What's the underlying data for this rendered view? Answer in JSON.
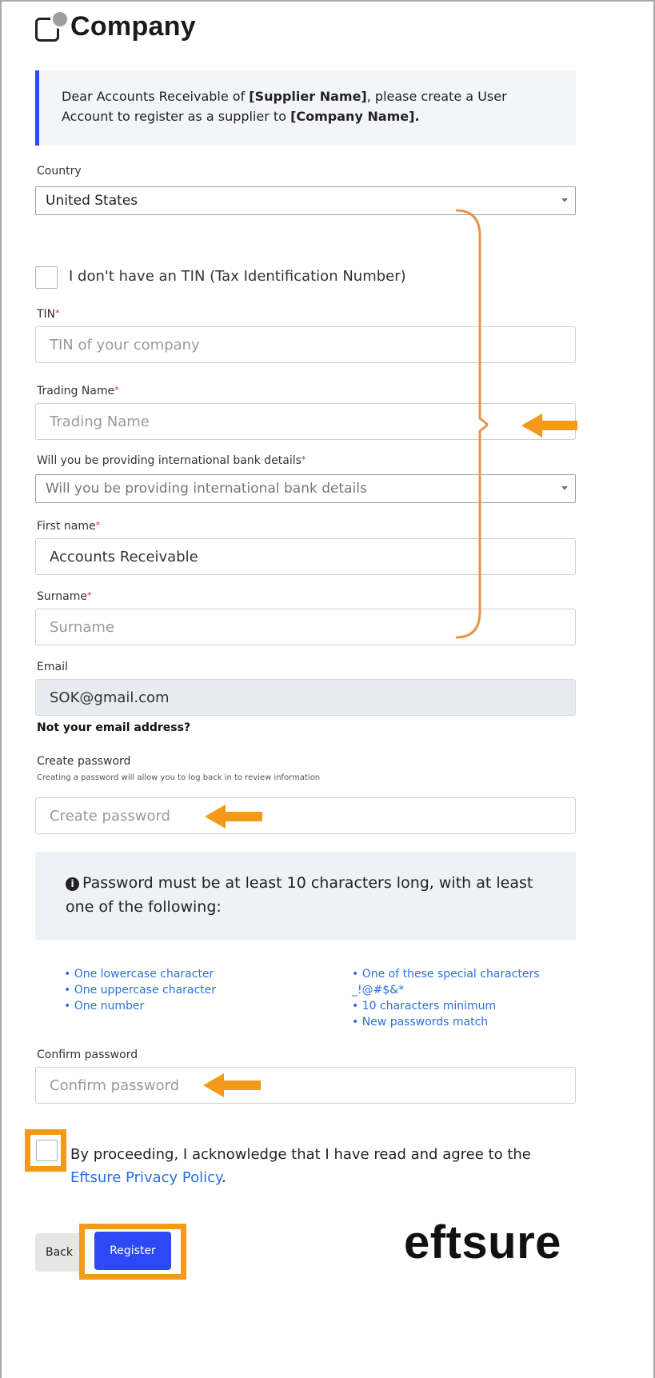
{
  "logo": {
    "text": "Company"
  },
  "banner": {
    "prefix": "Dear Accounts Receivable of ",
    "supplier": "[Supplier Name]",
    "middle": ", please create a User Account to register as a supplier to ",
    "company": "[Company Name]."
  },
  "country": {
    "label": "Country",
    "value": "United States"
  },
  "no_tin": {
    "label": "I don't have an TIN (Tax Identification Number)"
  },
  "tin": {
    "label": "TIN",
    "required_mark": "*",
    "placeholder": "TIN of your company"
  },
  "trading_name": {
    "label": "Trading Name",
    "required_mark": "*",
    "placeholder": "Trading Name"
  },
  "intl_bank": {
    "label": "Will you be providing international bank details",
    "required_mark": "*",
    "placeholder": "Will you be providing international bank details"
  },
  "first_name": {
    "label": "First name",
    "required_mark": "*",
    "value": "Accounts Receivable"
  },
  "surname": {
    "label": "Surname",
    "required_mark": "*",
    "placeholder": "Surname"
  },
  "email": {
    "label": "Email",
    "value": "SOK@gmail.com",
    "not_yours": "Not your email address?"
  },
  "create_password": {
    "label": "Create password",
    "help": "Creating a password will allow you to log back in to review information",
    "placeholder": "Create password"
  },
  "password_info": {
    "icon": "info-circle",
    "text": "Password must be at least 10 characters long, with at least one of the following:"
  },
  "rules_left": [
    "• One lowercase character",
    "• One uppercase character",
    "• One number"
  ],
  "rules_right": [
    "• One of these special characters",
    "_!@#$&*",
    "• 10 characters minimum",
    "• New passwords match"
  ],
  "confirm_password": {
    "label": "Confirm password",
    "placeholder": "Confirm password"
  },
  "agree": {
    "text": "By proceeding, I acknowledge that I have read and agree to the",
    "link": "Eftsure Privacy Policy",
    "suffix": "."
  },
  "buttons": {
    "back": "Back",
    "register": "Register"
  },
  "brand": {
    "text": "eftsure"
  },
  "colors": {
    "primary": "#2d49f5",
    "annotation": "#f39a1a",
    "link": "#2c6fe0",
    "required": "#d6262f"
  }
}
